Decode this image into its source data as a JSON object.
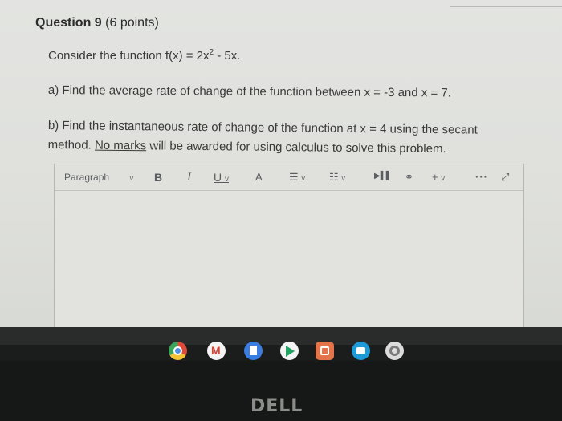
{
  "question": {
    "label": "Question 9",
    "points": "(6 points)",
    "intro_prefix": "Consider the function f(x) = 2x",
    "intro_exp": "2",
    "intro_suffix": " - 5x.",
    "part_a": "a)   Find the average rate of change of the function between x = -3 and x = 7.",
    "part_b_pre": "b)   Find the instantaneous rate of change of the function at x = 4 using the secant method. ",
    "part_b_no_marks": "No marks",
    "part_b_post": " will be awarded for using calculus to solve this problem."
  },
  "editor": {
    "block_format": "Paragraph",
    "chevron": "v",
    "bold_label": "B",
    "italic_label": "I",
    "underline_label": "U",
    "text_color_label": "A",
    "align_glyph": "☰",
    "list_glyph": "☷",
    "media_glyph": "▶▌▌",
    "link_glyph": "⚭",
    "insert_label": "+",
    "more_label": "···",
    "fullscreen_glyph": "⤢",
    "icons": [
      "chevron-down-icon",
      "align-icon",
      "list-icon",
      "media-icon",
      "link-icon",
      "plus-icon",
      "more-icon",
      "fullscreen-icon"
    ]
  },
  "shelf": {
    "apps": [
      "chrome-icon",
      "gmail-icon",
      "docs-icon",
      "play-store-icon",
      "files-icon",
      "chat-icon",
      "settings-icon"
    ],
    "gmail_letter": "M"
  },
  "bezel": {
    "logo": "DELL"
  },
  "colors": {
    "screen_bg": "#e0e1dd",
    "text": "#3a3a38",
    "bezel": "#161817"
  }
}
